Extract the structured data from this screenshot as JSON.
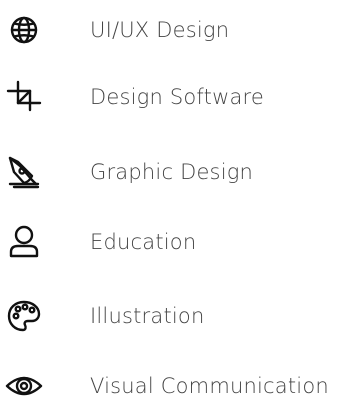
{
  "items": [
    {
      "label": "UI/UX Design",
      "icon": "globe-icon"
    },
    {
      "label": "Design Software",
      "icon": "crop-icon"
    },
    {
      "label": "Graphic Design",
      "icon": "pen-nib-icon"
    },
    {
      "label": "Education",
      "icon": "user-icon"
    },
    {
      "label": "Illustration",
      "icon": "palette-icon"
    },
    {
      "label": "Visual Communication",
      "icon": "eye-icon"
    }
  ]
}
